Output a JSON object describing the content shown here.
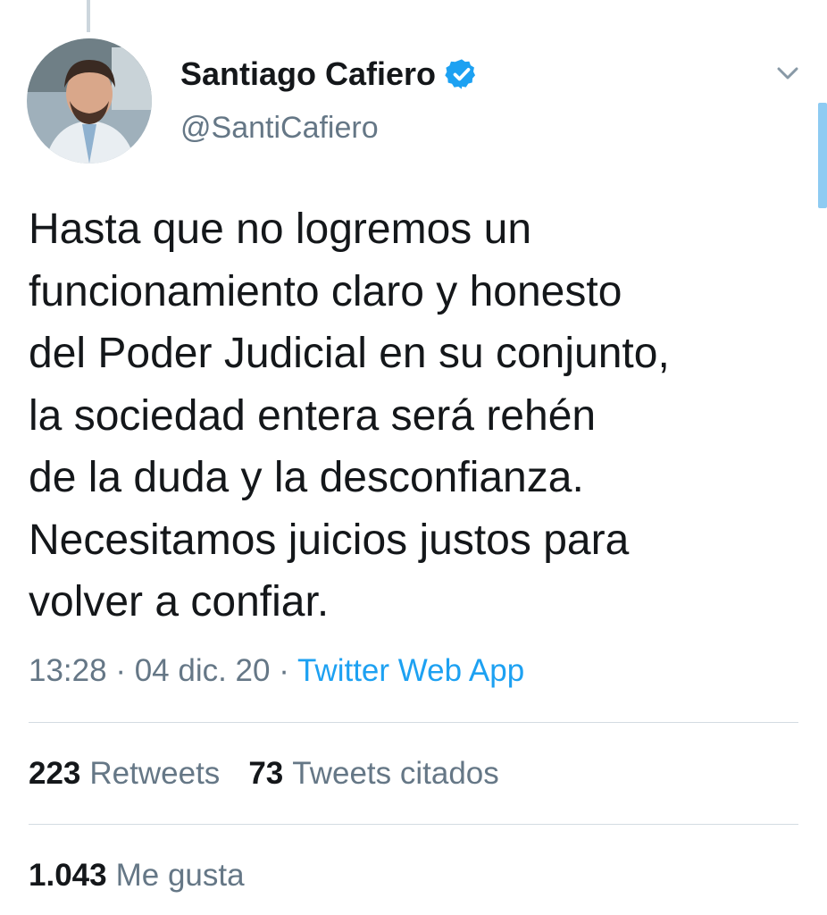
{
  "author": {
    "display_name": "Santiago Cafiero",
    "handle": "@SantiCafiero",
    "verified": true
  },
  "tweet": {
    "text_lines": [
      "Hasta que no logremos un",
      "funcionamiento claro y honesto",
      "del Poder Judicial en su conjunto,",
      "la sociedad entera será rehén",
      "de la duda y la desconfianza.",
      "Necesitamos juicios justos para",
      "volver a confiar."
    ],
    "time": "13:28",
    "date": "04 dic. 20",
    "separator": " · ",
    "source": "Twitter Web App"
  },
  "stats": {
    "retweets_count": "223",
    "retweets_label": "Retweets",
    "quotes_count": "73",
    "quotes_label": "Tweets citados",
    "likes_count": "1.043",
    "likes_label": "Me gusta"
  },
  "icons": {
    "verified": "verified-badge-icon",
    "caret": "chevron-down-icon"
  },
  "colors": {
    "link_blue": "#1da1f2",
    "secondary_text": "#657786",
    "primary_text": "#14171a",
    "divider": "#d3dbe2"
  }
}
